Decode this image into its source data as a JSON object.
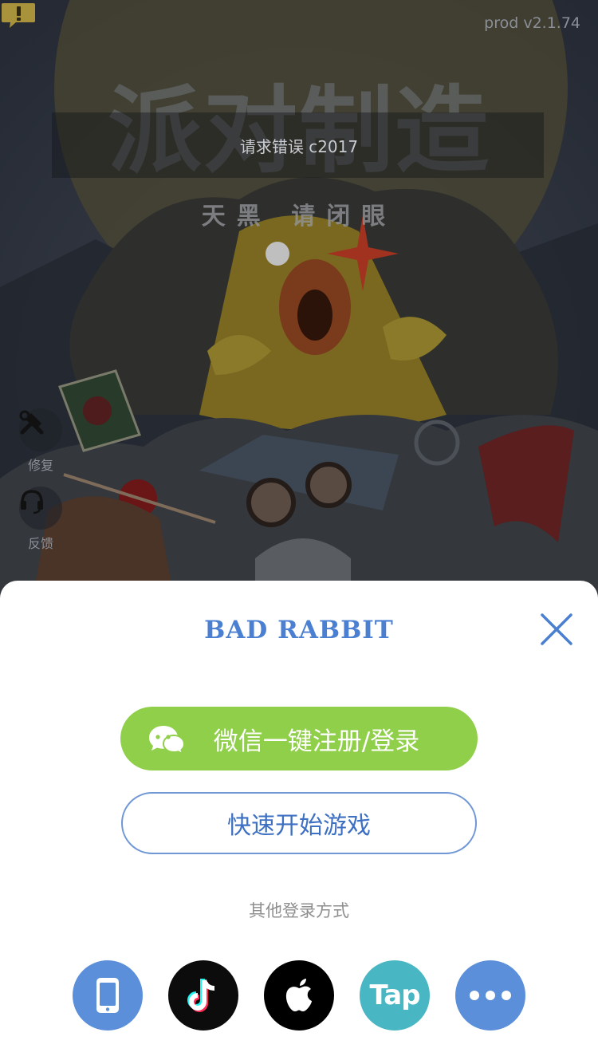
{
  "background": {
    "version": "prod v2.1.74",
    "title_art": "派对制造",
    "subtitle_art": "天黑 请闭眼",
    "error_message": "请求错误 c2017",
    "side_tools": [
      {
        "label": "修复",
        "icon": "hammer-wrench-icon"
      },
      {
        "label": "反馈",
        "icon": "headset-icon"
      }
    ]
  },
  "sheet": {
    "brand": "BAD RABBIT",
    "wechat_button": "微信一键注册/登录",
    "quick_start_button": "快速开始游戏",
    "other_methods_label": "其他登录方式",
    "login_options": [
      {
        "name": "phone",
        "icon": "phone-icon"
      },
      {
        "name": "tiktok",
        "icon": "tiktok-icon"
      },
      {
        "name": "apple",
        "icon": "apple-icon"
      },
      {
        "name": "taptap",
        "icon": "taptap-icon",
        "text": "Tap"
      },
      {
        "name": "more",
        "icon": "more-icon"
      }
    ]
  },
  "colors": {
    "brand_blue": "#4a7fd1",
    "wechat_green": "#90cf49",
    "tap_teal": "#49b6c4",
    "phone_blue": "#5b8fd9"
  }
}
